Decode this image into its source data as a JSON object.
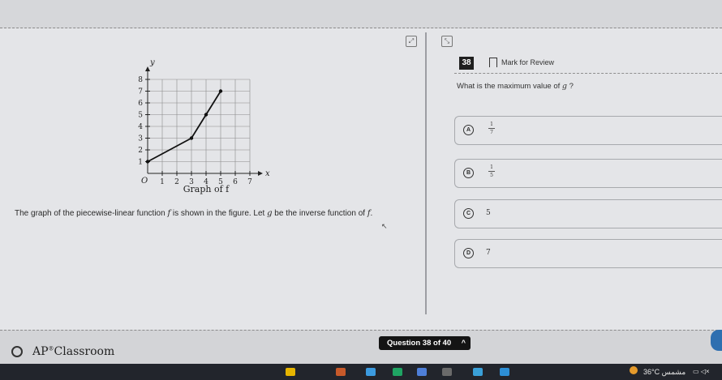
{
  "question": {
    "number": "38",
    "mark_label": "Mark for Review",
    "prompt_a": "What is the maximum value of ",
    "prompt_var": "g",
    "prompt_b": " ?",
    "stem_a": "The graph of the piecewise-linear function ",
    "stem_f": "f",
    "stem_b": " is shown in the figure. Let ",
    "stem_g": "g",
    "stem_c": " be the inverse function of ",
    "stem_d": "f",
    "stem_e": ".",
    "choices": [
      {
        "letter": "A",
        "num": "1",
        "den": "7"
      },
      {
        "letter": "B",
        "num": "1",
        "den": "5"
      },
      {
        "letter": "C",
        "text": "5"
      },
      {
        "letter": "D",
        "text": "7"
      }
    ]
  },
  "graph": {
    "caption": "Graph of f",
    "y_label": "y",
    "x_label": "x",
    "origin_label": "O",
    "chart_data": {
      "type": "line",
      "title": "Graph of f",
      "xlabel": "x",
      "ylabel": "y",
      "xlim": [
        0,
        7
      ],
      "ylim": [
        0,
        8
      ],
      "grid": true,
      "x_ticks": [
        "1",
        "2",
        "3",
        "4",
        "5",
        "6",
        "7"
      ],
      "y_ticks": [
        "1",
        "2",
        "3",
        "4",
        "5",
        "6",
        "7",
        "8"
      ],
      "series": [
        {
          "x": [
            0,
            3,
            4,
            5
          ],
          "y": [
            1,
            3,
            5,
            7
          ]
        }
      ]
    }
  },
  "footer": {
    "brand": "AP",
    "brand_sup": "®",
    "brand_rest": "Classroom",
    "nav_label": "Question 38 of 40",
    "nav_chevron": "^"
  },
  "tray": {
    "temperature": "36°C",
    "weather": "مشمس"
  }
}
